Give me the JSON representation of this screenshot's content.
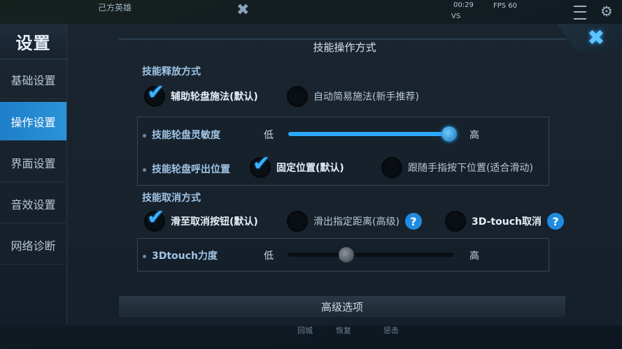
{
  "hud": {
    "team_label": "己方英雄",
    "time": "00:29",
    "vs": "VS",
    "fps": "FPS 60"
  },
  "sidebar": {
    "title": "设置",
    "items": [
      {
        "label": "基础设置",
        "active": false
      },
      {
        "label": "操作设置",
        "active": true
      },
      {
        "label": "界面设置",
        "active": false
      },
      {
        "label": "音效设置",
        "active": false
      },
      {
        "label": "网络诊断",
        "active": false
      }
    ]
  },
  "panel": {
    "title": "技能操作方式",
    "release": {
      "heading": "技能释放方式",
      "opt1": "辅助轮盘施法(默认)",
      "opt2": "自动简易施法(新手推荐)"
    },
    "sensitivity": {
      "label": "技能轮盘灵敏度",
      "low": "低",
      "high": "高",
      "value": 0.97
    },
    "position": {
      "label": "技能轮盘呼出位置",
      "opt1": "固定位置(默认)",
      "opt2": "跟随手指按下位置(适合滑动)"
    },
    "cancel": {
      "heading": "技能取消方式",
      "opt1": "滑至取消按钮(默认)",
      "opt2": "滑出指定距离(高级)",
      "opt3": "3D-touch取消",
      "help": "?"
    },
    "touch3d": {
      "label": "3Dtouch力度",
      "low": "低",
      "high": "高",
      "value": 0.35
    },
    "advanced": "高级选项"
  },
  "bottom": {
    "b1": "回城",
    "b2": "恢复",
    "b3": "惩击"
  },
  "colors": {
    "accent": "#2da8ff",
    "active_tab": "#1d7fc9"
  }
}
